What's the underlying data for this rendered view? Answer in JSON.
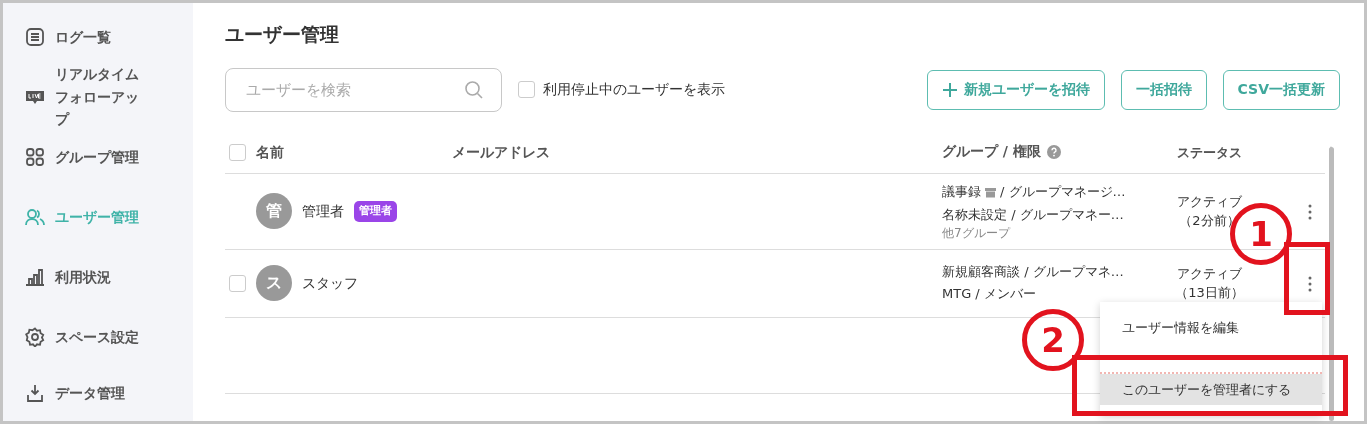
{
  "sidebar": {
    "items": [
      {
        "label": "ログ一覧",
        "selected": false
      },
      {
        "label": "リアルタイムフォローアップ",
        "selected": false
      },
      {
        "label": "グループ管理",
        "selected": false
      },
      {
        "label": "ユーザー管理",
        "selected": true
      },
      {
        "label": "利用状況",
        "selected": false
      },
      {
        "label": "スペース設定",
        "selected": false
      },
      {
        "label": "データ管理",
        "selected": false
      }
    ]
  },
  "page_title": "ユーザー管理",
  "search": {
    "placeholder": "ユーザーを検索"
  },
  "show_suspended": {
    "label": "利用停止中のユーザーを表示",
    "checked": false
  },
  "buttons": [
    {
      "label": "新規ユーザーを招待",
      "kind": "add"
    },
    {
      "label": "一括招待",
      "kind": "plain"
    },
    {
      "label": "CSV一括更新",
      "kind": "plain"
    }
  ],
  "table": {
    "all_checked": false,
    "columns": [
      "名前",
      "メールアドレス",
      "グループ / 権限",
      "ステータス"
    ],
    "rows": [
      {
        "selectable": false,
        "avatar": "管",
        "name": "管理者",
        "badge": "管理者",
        "groups": [
          {
            "text": "議事録",
            "archived": true,
            "after": "/ グループマネージ…"
          },
          {
            "text": "名称未設定 / グループマネー…",
            "archived": false
          }
        ],
        "more": "他7グループ",
        "status": "アクティブ",
        "last_seen": "（2分前）"
      },
      {
        "selectable": true,
        "checked": false,
        "avatar": "ス",
        "name": "スタッフ",
        "groups": [
          {
            "text": "新規顧客商談 / グループマネ…",
            "archived": false
          },
          {
            "text": "MTG / メンバー",
            "archived": false
          }
        ],
        "status": "アクティブ",
        "last_seen": "（13日前）"
      }
    ]
  },
  "menu": {
    "items": [
      {
        "label": "ユーザー情報を編集",
        "kind": "normal",
        "selected": false
      },
      {
        "kind": "danger",
        "selected": false
      },
      {
        "label": "このユーザーを管理者にする",
        "kind": "normal",
        "selected": true
      }
    ]
  },
  "annotations": [
    {
      "kind": "number",
      "text": "1"
    },
    {
      "kind": "frame"
    },
    {
      "kind": "number",
      "text": "2"
    },
    {
      "kind": "frame"
    }
  ]
}
